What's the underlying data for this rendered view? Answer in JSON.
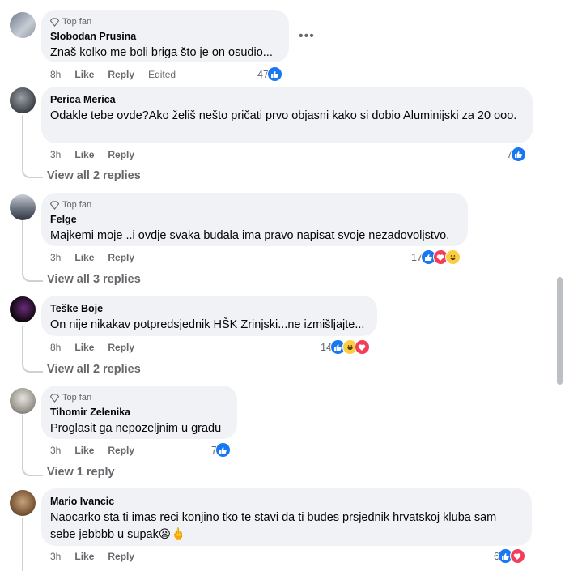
{
  "badge_label": "Top fan",
  "colors": {
    "like": "#1877f2",
    "love": "#f33e58",
    "haha": "#fbcd44",
    "bubble": "#f0f2f5",
    "meta": "#65676b"
  },
  "comments": [
    {
      "author": "Slobodan Prusina",
      "top_fan": true,
      "text": "Znaš kolko me boli briga što je on osudio...",
      "time": "8h",
      "like": "Like",
      "reply": "Reply",
      "edited": "Edited",
      "reaction_count": "47",
      "reactions": [
        "like"
      ]
    },
    {
      "author": "Perica Merica",
      "top_fan": false,
      "text": "Odakle tebe ovde?Ako želiš nešto pričati prvo objasni kako si dobio Aluminijski za 20 ooo.",
      "time": "3h",
      "like": "Like",
      "reply": "Reply",
      "reaction_count": "7",
      "reactions": [
        "like"
      ],
      "view_replies": "View all 2 replies"
    },
    {
      "author": "Felge",
      "top_fan": true,
      "text": "Majkemi moje ..i ovdje svaka budala ima pravo napisat svoje nezadovoljstvo.",
      "time": "3h",
      "like": "Like",
      "reply": "Reply",
      "reaction_count": "17",
      "reactions": [
        "like",
        "love",
        "haha"
      ],
      "view_replies": "View all 3 replies"
    },
    {
      "author": "Teške Boje",
      "top_fan": false,
      "text": "On nije nikakav potpredsjednik HŠK Zrinjski...ne izmišljajte...",
      "time": "8h",
      "like": "Like",
      "reply": "Reply",
      "reaction_count": "14",
      "reactions": [
        "like",
        "haha",
        "love"
      ],
      "view_replies": "View all 2 replies"
    },
    {
      "author": "Tihomir Zelenika",
      "top_fan": true,
      "text": "Proglasit ga nepozeljnim u gradu",
      "time": "3h",
      "like": "Like",
      "reply": "Reply",
      "reaction_count": "7",
      "reactions": [
        "like"
      ],
      "view_replies": "View 1 reply"
    },
    {
      "author": "Mario Ivancic",
      "top_fan": false,
      "text": "Naocarko sta ti imas reci konjino tko te stavi da ti budes prsjednik hrvatskoj kluba sam sebe jebbbb u supak😫🖕",
      "time": "3h",
      "like": "Like",
      "reply": "Reply",
      "reaction_count": "6",
      "reactions": [
        "like",
        "love"
      ]
    }
  ]
}
